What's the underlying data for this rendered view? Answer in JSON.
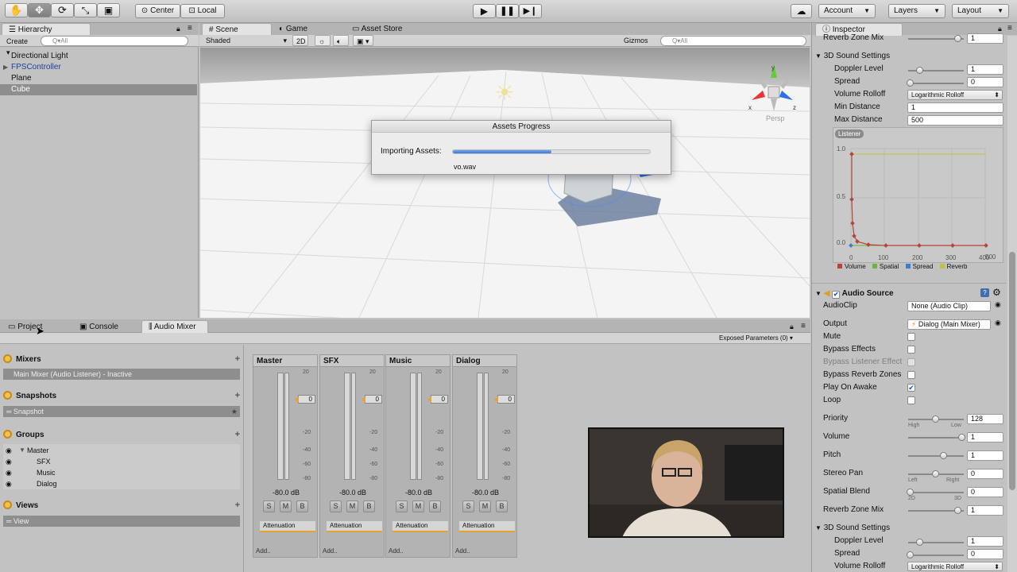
{
  "toolbar": {
    "pivot_label": "Center",
    "space_label": "Local",
    "account_label": "Account",
    "layers_label": "Layers",
    "layout_label": "Layout"
  },
  "hierarchy": {
    "tab_label": "Hierarchy",
    "create_label": "Create",
    "search_placeholder": "Q▾All",
    "items": [
      "Directional Light",
      "FPSController",
      "Plane",
      "Cube"
    ]
  },
  "scene": {
    "tabs": [
      "Scene",
      "Game",
      "Asset Store"
    ],
    "shading_mode": "Shaded",
    "mode_2d": "2D",
    "gizmos_label": "Gizmos",
    "search_placeholder": "Q▾All",
    "persp_label": "Persp",
    "axes": {
      "x": "x",
      "y": "y",
      "z": "z"
    }
  },
  "progress_dialog": {
    "title": "Assets Progress",
    "label": "Importing Assets:",
    "progress": 0.5,
    "file": "vo.wav"
  },
  "bottom_tabs": [
    "Project",
    "Console",
    "Audio Mixer"
  ],
  "exposed_params": "Exposed Parameters (0)",
  "mixer_panel": {
    "mixers_title": "Mixers",
    "mixer_item": "Main Mixer   (Audio Listener) - Inactive",
    "snapshots_title": "Snapshots",
    "snapshot_item": "Snapshot",
    "groups_title": "Groups",
    "groups": [
      "Master",
      "SFX",
      "Music",
      "Dialog"
    ],
    "views_title": "Views",
    "view_item": "View"
  },
  "strips": [
    {
      "name": "Master",
      "db": "-80.0 dB"
    },
    {
      "name": "SFX",
      "db": "-80.0 dB"
    },
    {
      "name": "Music",
      "db": "-80.0 dB"
    },
    {
      "name": "Dialog",
      "db": "-80.0 dB"
    }
  ],
  "strip_labels": {
    "scale": [
      "20",
      "0",
      "-20",
      "-40",
      "-60",
      "-80"
    ],
    "fader_value": "0",
    "solo": "S",
    "mute": "M",
    "bypass": "B",
    "effect": "Attenuation",
    "add": "Add.."
  },
  "inspector": {
    "tab_label": "Inspector",
    "top_reverb_label": "Reverb Zone Mix",
    "top_reverb_value": "1",
    "sound3d_title": "3D Sound Settings",
    "doppler_label": "Doppler Level",
    "doppler_value": "1",
    "spread_label": "Spread",
    "spread_value": "0",
    "rolloff_label": "Volume Rolloff",
    "rolloff_value": "Logarithmic Rolloff",
    "min_label": "Min Distance",
    "min_value": "1",
    "max_label": "Max Distance",
    "max_value": "500",
    "graph": {
      "listener_label": "Listener",
      "y_ticks": [
        "1.0",
        "0.5",
        "0.0"
      ],
      "x_ticks": [
        "0",
        "100",
        "200",
        "300",
        "400",
        "500"
      ],
      "legend": [
        "Volume",
        "Spatial",
        "Spread",
        "Reverb"
      ],
      "colors": {
        "volume": "#b5453a",
        "spatial": "#6db33f",
        "spread": "#3d7fc7",
        "reverb": "#c2c23a"
      }
    },
    "audio_source": {
      "title": "Audio Source",
      "clip_label": "AudioClip",
      "clip_value": "None (Audio Clip)",
      "output_label": "Output",
      "output_value": "Dialog (Main Mixer)",
      "mute_label": "Mute",
      "bypass_effects_label": "Bypass Effects",
      "bypass_listener_label": "Bypass Listener Effect",
      "bypass_reverb_label": "Bypass Reverb Zones",
      "play_on_awake_label": "Play On Awake",
      "loop_label": "Loop",
      "priority_label": "Priority",
      "priority_value": "128",
      "priority_low": "High",
      "priority_high": "Low",
      "volume_label": "Volume",
      "volume_value": "1",
      "pitch_label": "Pitch",
      "pitch_value": "1",
      "pan_label": "Stereo Pan",
      "pan_value": "0",
      "pan_left": "Left",
      "pan_right": "Right",
      "blend_label": "Spatial Blend",
      "blend_value": "0",
      "blend_min": "2D",
      "blend_max": "3D",
      "reverb_label": "Reverb Zone Mix",
      "reverb_value": "1",
      "sound3d_title": "3D Sound Settings",
      "doppler_label": "Doppler Level",
      "doppler_value": "1",
      "spread_label": "Spread",
      "spread_value": "0",
      "rolloff_label": "Volume Rolloff",
      "rolloff_value": "Logarithmic Rolloff"
    }
  }
}
